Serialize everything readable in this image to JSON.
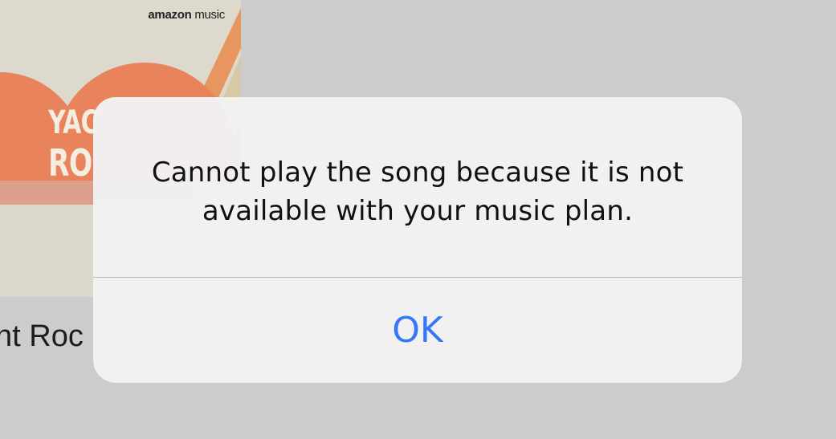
{
  "background": {
    "album": {
      "brand_bold": "amazon",
      "brand_light": " music",
      "art_line_1": "YAC",
      "art_line_2": "RO",
      "title_visible": "nt Roc"
    }
  },
  "alert": {
    "message": "Cannot play the song because it is not available with your music plan.",
    "ok_label": "OK"
  },
  "colors": {
    "accent": "#3478f6",
    "backdrop": "#cccccc",
    "alert_bg": "#f2f2f2"
  }
}
